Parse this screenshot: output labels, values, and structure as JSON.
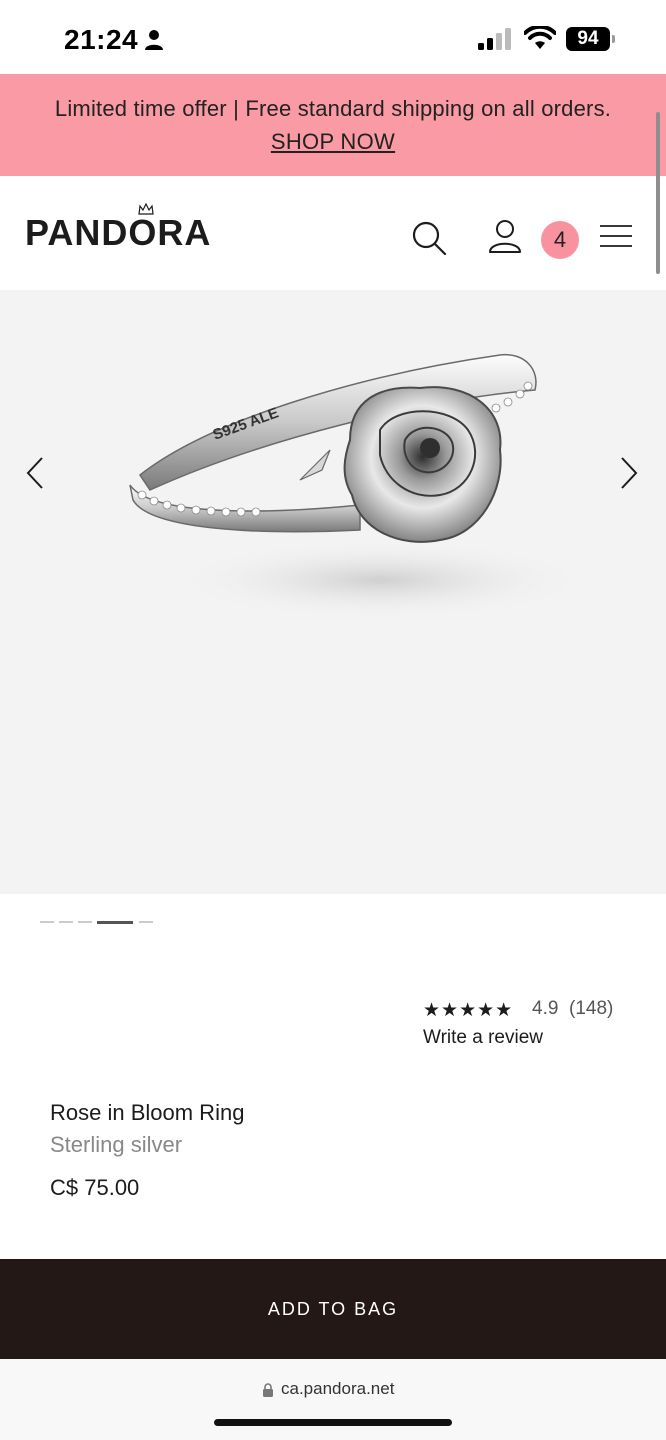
{
  "status_bar": {
    "time": "21:24",
    "battery": "94"
  },
  "promo": {
    "text": "Limited time offer | Free standard shipping on all orders.",
    "link": "SHOP NOW",
    "color": "#fa9aa4"
  },
  "header": {
    "logo": "PANDORA",
    "cart_count": "4",
    "icons": [
      "search-icon",
      "account-icon",
      "menu-icon"
    ]
  },
  "gallery": {
    "engraving": "S925 ALE",
    "active_image": 4,
    "image_count": 5
  },
  "rating": {
    "stars": "★★★★★",
    "value": "4.9",
    "count": "(148)",
    "write_review": "Write a review"
  },
  "product": {
    "name": "Rose in Bloom Ring",
    "material": "Sterling silver",
    "price": "C$ 75.00"
  },
  "cta": {
    "add_to_bag": "ADD TO BAG",
    "color": "#231815"
  },
  "browser": {
    "url": "ca.pandora.net"
  }
}
